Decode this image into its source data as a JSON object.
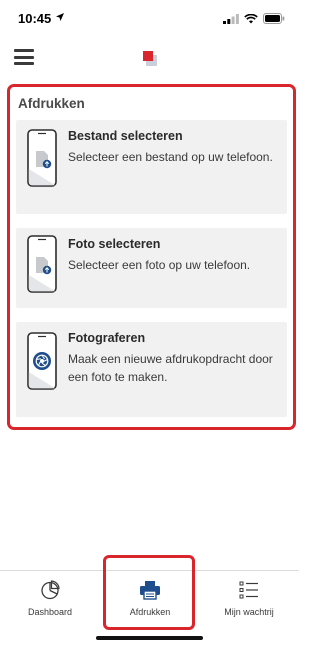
{
  "status_bar": {
    "time": "10:45"
  },
  "panel": {
    "title": "Afdrukken",
    "options": [
      {
        "title": "Bestand selecteren",
        "description": "Selecteer een bestand op uw telefoon.",
        "icon": "file-upload-icon"
      },
      {
        "title": "Foto selecteren",
        "description": "Selecteer een foto op uw telefoon.",
        "icon": "photo-upload-icon"
      },
      {
        "title": "Fotograferen",
        "description": "Maak een nieuwe afdrukopdracht door een foto te maken.",
        "icon": "camera-icon"
      }
    ]
  },
  "tab_bar": {
    "tabs": [
      {
        "label": "Dashboard",
        "icon": "pie-chart-icon"
      },
      {
        "label": "Afdrukken",
        "icon": "printer-icon",
        "active": true
      },
      {
        "label": "Mijn wachtrij",
        "icon": "list-icon"
      }
    ]
  },
  "colors": {
    "accent": "#1f4e8c",
    "highlight_border": "#d8262c",
    "card_bg": "#f1f1f2",
    "logo_red": "#d8262c"
  }
}
